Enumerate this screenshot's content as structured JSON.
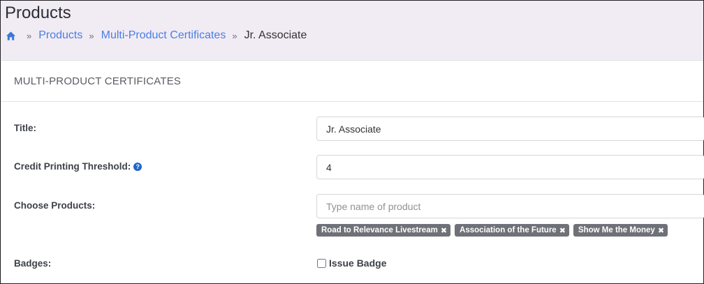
{
  "page": {
    "title": "Products"
  },
  "breadcrumb": {
    "items": [
      {
        "label": "Products"
      },
      {
        "label": "Multi-Product Certificates"
      }
    ],
    "current": "Jr. Associate",
    "separator": "»"
  },
  "card": {
    "title": "MULTI-PRODUCT CERTIFICATES"
  },
  "form": {
    "title": {
      "label": "Title:",
      "value": "Jr. Associate"
    },
    "threshold": {
      "label": "Credit Printing Threshold:",
      "value": "4",
      "help_icon": "question-circle-icon"
    },
    "products": {
      "label": "Choose Products:",
      "placeholder": "Type name of product",
      "tags": [
        {
          "label": "Road to Relevance Livestream",
          "remove": "✖"
        },
        {
          "label": "Association of the Future",
          "remove": "✖"
        },
        {
          "label": "Show Me the Money",
          "remove": "✖"
        }
      ]
    },
    "badges": {
      "label": "Badges:",
      "checkbox_label": "Issue Badge",
      "checked": false
    }
  },
  "colors": {
    "link": "#4a7fe2",
    "header_bg": "#f1ebf4",
    "tag_bg": "#6f7178",
    "help_icon": "#1f66c8"
  }
}
